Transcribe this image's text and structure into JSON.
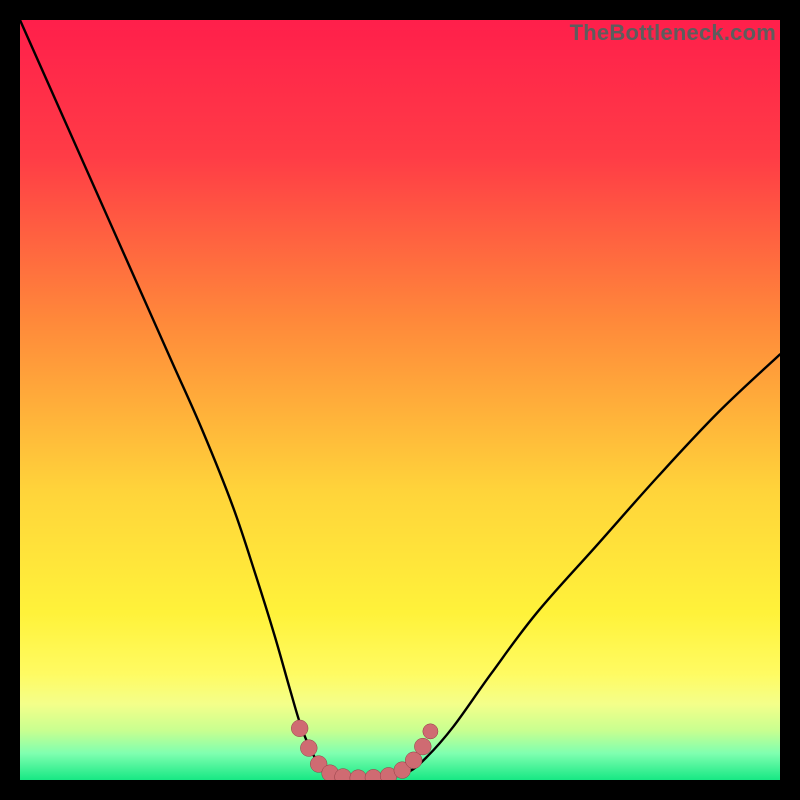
{
  "watermark": "TheBottleneck.com",
  "colors": {
    "frame": "#000000",
    "gradient_stops": [
      {
        "offset": 0,
        "color": "#ff1f4b"
      },
      {
        "offset": 18,
        "color": "#ff3c46"
      },
      {
        "offset": 40,
        "color": "#ff8a3a"
      },
      {
        "offset": 62,
        "color": "#ffd43a"
      },
      {
        "offset": 78,
        "color": "#fff23a"
      },
      {
        "offset": 86,
        "color": "#fffb62"
      },
      {
        "offset": 90,
        "color": "#f4ff8a"
      },
      {
        "offset": 93.5,
        "color": "#c8ff90"
      },
      {
        "offset": 96.5,
        "color": "#7fffb0"
      },
      {
        "offset": 100,
        "color": "#17e884"
      }
    ],
    "curve": "#000000",
    "marker_fill": "#cf6b72",
    "marker_stroke": "#8e3d44"
  },
  "chart_data": {
    "type": "line",
    "title": "",
    "xlabel": "",
    "ylabel": "",
    "xlim": [
      0,
      100
    ],
    "ylim": [
      0,
      100
    ],
    "grid": false,
    "legend": false,
    "series": [
      {
        "name": "bottleneck-curve",
        "x": [
          0,
          4,
          8,
          12,
          16,
          20,
          24,
          28,
          31,
          33.5,
          35.5,
          37,
          38.5,
          40,
          42,
          45,
          48,
          51,
          53.5,
          57,
          62,
          68,
          76,
          84,
          92,
          100
        ],
        "y": [
          100,
          91,
          82,
          73,
          64,
          55,
          46,
          36,
          27,
          19,
          12,
          7,
          3.5,
          1.2,
          0.4,
          0.2,
          0.3,
          1.0,
          3.0,
          7,
          14,
          22,
          31,
          40,
          48.5,
          56
        ]
      }
    ],
    "markers": {
      "name": "bottom-cluster",
      "points": [
        {
          "x": 36.8,
          "y": 6.8,
          "r": 1.1
        },
        {
          "x": 38.0,
          "y": 4.2,
          "r": 1.1
        },
        {
          "x": 39.3,
          "y": 2.1,
          "r": 1.1
        },
        {
          "x": 40.8,
          "y": 0.9,
          "r": 1.1
        },
        {
          "x": 42.5,
          "y": 0.4,
          "r": 1.1
        },
        {
          "x": 44.5,
          "y": 0.25,
          "r": 1.1
        },
        {
          "x": 46.5,
          "y": 0.3,
          "r": 1.1
        },
        {
          "x": 48.5,
          "y": 0.55,
          "r": 1.1
        },
        {
          "x": 50.3,
          "y": 1.3,
          "r": 1.1
        },
        {
          "x": 51.8,
          "y": 2.6,
          "r": 1.1
        },
        {
          "x": 53.0,
          "y": 4.4,
          "r": 1.1
        },
        {
          "x": 54.0,
          "y": 6.4,
          "r": 1.0
        }
      ]
    }
  }
}
